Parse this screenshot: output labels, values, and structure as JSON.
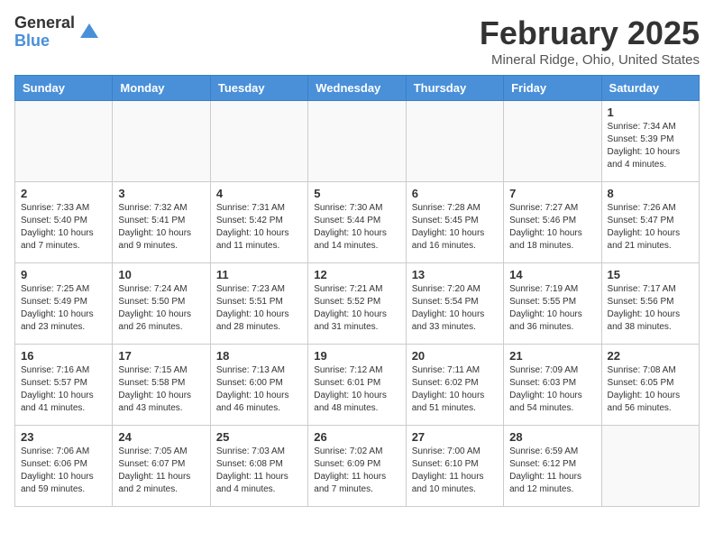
{
  "logo": {
    "general": "General",
    "blue": "Blue"
  },
  "title": "February 2025",
  "location": "Mineral Ridge, Ohio, United States",
  "headers": [
    "Sunday",
    "Monday",
    "Tuesday",
    "Wednesday",
    "Thursday",
    "Friday",
    "Saturday"
  ],
  "weeks": [
    [
      {
        "day": "",
        "info": ""
      },
      {
        "day": "",
        "info": ""
      },
      {
        "day": "",
        "info": ""
      },
      {
        "day": "",
        "info": ""
      },
      {
        "day": "",
        "info": ""
      },
      {
        "day": "",
        "info": ""
      },
      {
        "day": "1",
        "info": "Sunrise: 7:34 AM\nSunset: 5:39 PM\nDaylight: 10 hours and 4 minutes."
      }
    ],
    [
      {
        "day": "2",
        "info": "Sunrise: 7:33 AM\nSunset: 5:40 PM\nDaylight: 10 hours and 7 minutes."
      },
      {
        "day": "3",
        "info": "Sunrise: 7:32 AM\nSunset: 5:41 PM\nDaylight: 10 hours and 9 minutes."
      },
      {
        "day": "4",
        "info": "Sunrise: 7:31 AM\nSunset: 5:42 PM\nDaylight: 10 hours and 11 minutes."
      },
      {
        "day": "5",
        "info": "Sunrise: 7:30 AM\nSunset: 5:44 PM\nDaylight: 10 hours and 14 minutes."
      },
      {
        "day": "6",
        "info": "Sunrise: 7:28 AM\nSunset: 5:45 PM\nDaylight: 10 hours and 16 minutes."
      },
      {
        "day": "7",
        "info": "Sunrise: 7:27 AM\nSunset: 5:46 PM\nDaylight: 10 hours and 18 minutes."
      },
      {
        "day": "8",
        "info": "Sunrise: 7:26 AM\nSunset: 5:47 PM\nDaylight: 10 hours and 21 minutes."
      }
    ],
    [
      {
        "day": "9",
        "info": "Sunrise: 7:25 AM\nSunset: 5:49 PM\nDaylight: 10 hours and 23 minutes."
      },
      {
        "day": "10",
        "info": "Sunrise: 7:24 AM\nSunset: 5:50 PM\nDaylight: 10 hours and 26 minutes."
      },
      {
        "day": "11",
        "info": "Sunrise: 7:23 AM\nSunset: 5:51 PM\nDaylight: 10 hours and 28 minutes."
      },
      {
        "day": "12",
        "info": "Sunrise: 7:21 AM\nSunset: 5:52 PM\nDaylight: 10 hours and 31 minutes."
      },
      {
        "day": "13",
        "info": "Sunrise: 7:20 AM\nSunset: 5:54 PM\nDaylight: 10 hours and 33 minutes."
      },
      {
        "day": "14",
        "info": "Sunrise: 7:19 AM\nSunset: 5:55 PM\nDaylight: 10 hours and 36 minutes."
      },
      {
        "day": "15",
        "info": "Sunrise: 7:17 AM\nSunset: 5:56 PM\nDaylight: 10 hours and 38 minutes."
      }
    ],
    [
      {
        "day": "16",
        "info": "Sunrise: 7:16 AM\nSunset: 5:57 PM\nDaylight: 10 hours and 41 minutes."
      },
      {
        "day": "17",
        "info": "Sunrise: 7:15 AM\nSunset: 5:58 PM\nDaylight: 10 hours and 43 minutes."
      },
      {
        "day": "18",
        "info": "Sunrise: 7:13 AM\nSunset: 6:00 PM\nDaylight: 10 hours and 46 minutes."
      },
      {
        "day": "19",
        "info": "Sunrise: 7:12 AM\nSunset: 6:01 PM\nDaylight: 10 hours and 48 minutes."
      },
      {
        "day": "20",
        "info": "Sunrise: 7:11 AM\nSunset: 6:02 PM\nDaylight: 10 hours and 51 minutes."
      },
      {
        "day": "21",
        "info": "Sunrise: 7:09 AM\nSunset: 6:03 PM\nDaylight: 10 hours and 54 minutes."
      },
      {
        "day": "22",
        "info": "Sunrise: 7:08 AM\nSunset: 6:05 PM\nDaylight: 10 hours and 56 minutes."
      }
    ],
    [
      {
        "day": "23",
        "info": "Sunrise: 7:06 AM\nSunset: 6:06 PM\nDaylight: 10 hours and 59 minutes."
      },
      {
        "day": "24",
        "info": "Sunrise: 7:05 AM\nSunset: 6:07 PM\nDaylight: 11 hours and 2 minutes."
      },
      {
        "day": "25",
        "info": "Sunrise: 7:03 AM\nSunset: 6:08 PM\nDaylight: 11 hours and 4 minutes."
      },
      {
        "day": "26",
        "info": "Sunrise: 7:02 AM\nSunset: 6:09 PM\nDaylight: 11 hours and 7 minutes."
      },
      {
        "day": "27",
        "info": "Sunrise: 7:00 AM\nSunset: 6:10 PM\nDaylight: 11 hours and 10 minutes."
      },
      {
        "day": "28",
        "info": "Sunrise: 6:59 AM\nSunset: 6:12 PM\nDaylight: 11 hours and 12 minutes."
      },
      {
        "day": "",
        "info": ""
      }
    ]
  ]
}
